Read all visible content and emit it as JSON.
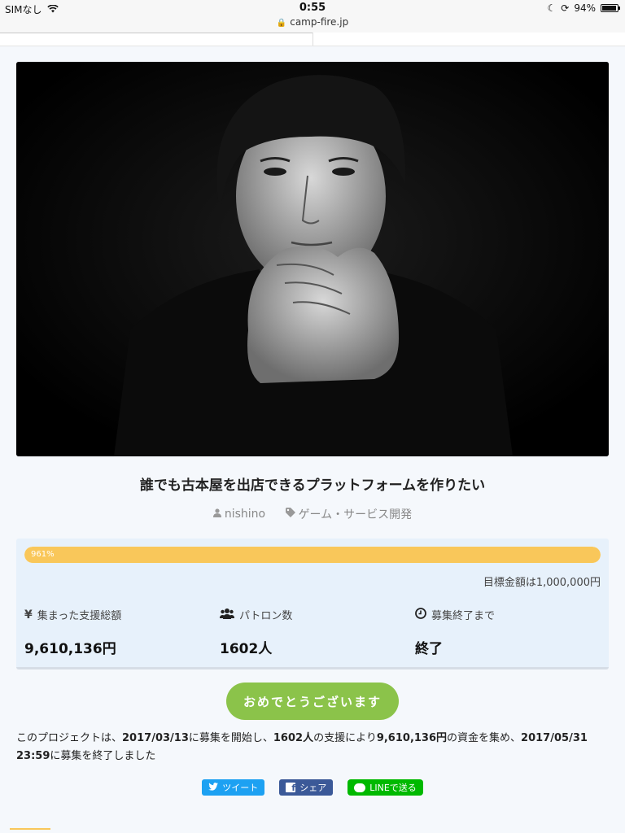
{
  "status_bar": {
    "carrier": "SIMなし",
    "time": "0:55",
    "battery": "94%"
  },
  "browser": {
    "url": "camp-fire.jp"
  },
  "project": {
    "title": "誰でも古本屋を出店できるプラットフォームを作りたい",
    "author": "nishino",
    "category": "ゲーム・サービス開発"
  },
  "funding": {
    "percent_label": "961%",
    "progress_fraction": 1.0,
    "goal_text": "目標金額は1,000,000円",
    "stats": [
      {
        "label": "集まった支援総額",
        "value": "9,610,136円",
        "icon": "yen-icon"
      },
      {
        "label": "パトロン数",
        "value": "1602人",
        "icon": "users-icon"
      },
      {
        "label": "募集終了まで",
        "value": "終了",
        "icon": "clock-icon"
      }
    ]
  },
  "congrats_button": "おめでとうございます",
  "description": {
    "p1": "このプロジェクトは、",
    "start_date": "2017/03/13",
    "p2": "に募集を開始し、",
    "patrons": "1602人",
    "p3": "の支援により",
    "amount": "9,610,136円",
    "p4": "の資金を集め、",
    "end_date": "2017/05/31 23:59",
    "p5": "に募集を終了しました"
  },
  "share": {
    "twitter": "ツイート",
    "facebook": "シェア",
    "line": "LINEで送る"
  },
  "colors": {
    "progress": "#f9c75a",
    "congrats": "#8bc34a",
    "panel": "#e7f1fb",
    "twitter": "#1da1f2",
    "facebook": "#3b5998",
    "line": "#00b900"
  }
}
